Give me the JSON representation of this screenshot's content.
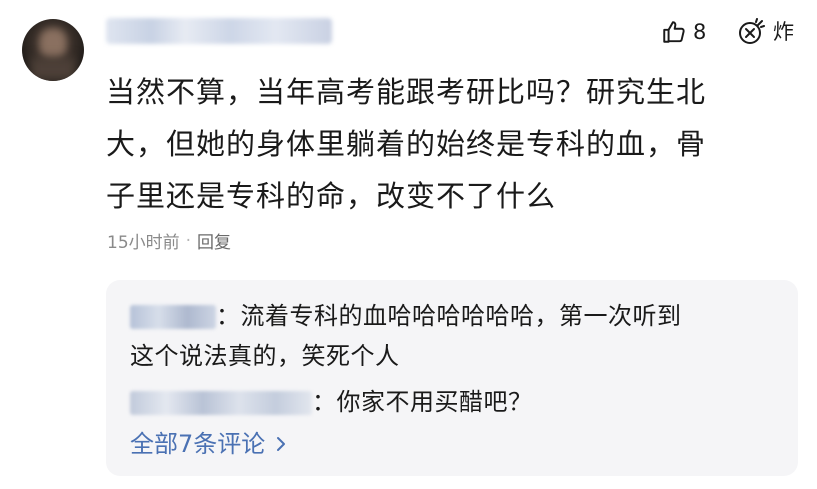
{
  "comment": {
    "text_lines": [
      "当然不算，当年高考能跟考研比吗？研究生北",
      "大，但她的身体里躺着的始终是专科的血，骨",
      "子里还是专科的命，改变不了什么"
    ],
    "like_count": "8",
    "boom_label": "炸",
    "time": "15小时前",
    "separator": "·",
    "reply_label": "回复"
  },
  "sub_comments": {
    "items": [
      {
        "text_line1": "：流着专科的血哈哈哈哈哈哈，第一次听到",
        "text_line2": "这个说法真的，笑死个人"
      },
      {
        "text_line1": "：你家不用买醋吧？"
      }
    ],
    "more_label": "全部7条评论"
  },
  "icons": {
    "like": "thumbs-up-icon",
    "boom": "firecracker-icon",
    "more": "chevron-right-icon"
  },
  "colors": {
    "link": "#4a71b3",
    "meta": "#8a8a8a",
    "sub_bg": "#f5f5f7"
  }
}
